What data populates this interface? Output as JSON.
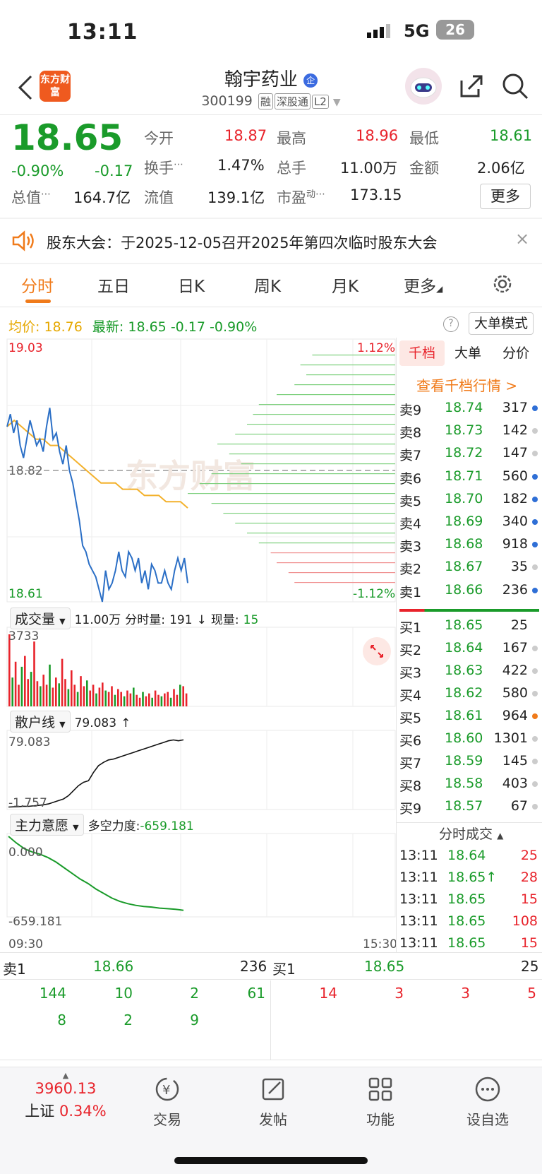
{
  "status_bar": {
    "time": "13:11",
    "network": "5G",
    "battery": "26"
  },
  "header": {
    "title": "翰宇药业",
    "code": "300199",
    "tags": [
      "融",
      "深股通",
      "L2"
    ],
    "logo_text": "东方财富"
  },
  "quote": {
    "price": "18.65",
    "change_pct": "-0.90%",
    "change": "-0.17",
    "open_label": "今开",
    "open": "18.87",
    "high_label": "最高",
    "high": "18.96",
    "low_label": "最低",
    "low": "18.61",
    "turnover_label": "换手",
    "turnover": "1.47%",
    "volume_label": "总手",
    "volume": "11.00万",
    "amount_label": "金额",
    "amount": "2.06亿",
    "mktcap_label": "总值",
    "mktcap": "164.7亿",
    "float_label": "流值",
    "float": "139.1亿",
    "pe_label": "市盈",
    "pe_sup": "动",
    "pe": "173.15",
    "more": "更多"
  },
  "notice": {
    "label": "股东大会：",
    "text": "于2025-12-05召开2025年第四次临时股东大会"
  },
  "tabs": [
    "分时",
    "五日",
    "日K",
    "周K",
    "月K",
    "更多"
  ],
  "chart_info": {
    "avg_label": "均价:",
    "avg": "18.76",
    "latest_label": "最新:",
    "latest": "18.65",
    "latest_chg": "-0.17",
    "latest_pct": "-0.90%",
    "mode_btn": "大单模式"
  },
  "chart_data": {
    "type": "line",
    "y_top": "19.03",
    "y_mid": "18.82",
    "y_bottom": "18.61",
    "pct_top": "1.12%",
    "pct_bottom": "-1.12%",
    "ylim": [
      18.61,
      19.03
    ],
    "price_series": [
      18.89,
      18.91,
      18.88,
      18.9,
      18.86,
      18.84,
      18.87,
      18.9,
      18.88,
      18.86,
      18.87,
      18.85,
      18.89,
      18.92,
      18.87,
      18.88,
      18.85,
      18.83,
      18.86,
      18.82,
      18.8,
      18.77,
      18.74,
      18.7,
      18.69,
      18.67,
      18.66,
      18.65,
      18.63,
      18.61,
      18.66,
      18.63,
      18.64,
      18.66,
      18.69,
      18.66,
      18.65,
      18.69,
      18.68,
      18.66,
      18.68,
      18.64,
      18.66,
      18.63,
      18.67,
      18.66,
      18.64,
      18.64,
      18.66,
      18.64,
      18.63,
      18.66,
      18.68,
      18.66,
      18.68,
      18.64
    ],
    "avg_series": [
      18.89,
      18.9,
      18.89,
      18.88,
      18.87,
      18.87,
      18.86,
      18.86,
      18.85,
      18.84,
      18.83,
      18.82,
      18.81,
      18.8,
      18.8,
      18.8,
      18.79,
      18.79,
      18.79,
      18.78,
      18.78,
      18.78,
      18.77,
      18.77,
      18.77,
      18.76
    ],
    "volume_label": "成交量",
    "volume_total": "11.00万",
    "volume_minute_label": "分时量:",
    "volume_minute": "191",
    "volume_now_label": "现量:",
    "volume_now": "15",
    "volume_max": "3733",
    "retail_label": "散户线",
    "retail_value": "79.083",
    "retail_top": "79.083",
    "retail_bottom": "-1.757",
    "main_label": "主力意愿",
    "main_sub_label": "多空力度:",
    "main_value": "-659.181",
    "main_top": "0.000",
    "main_bottom": "-659.181",
    "time_start": "09:30",
    "time_end": "15:30"
  },
  "order_book": {
    "tabs": [
      "千档",
      "大单",
      "分价"
    ],
    "link": "查看千档行情 >",
    "asks": [
      {
        "label": "卖9",
        "price": "18.74",
        "vol": "317",
        "dot": "#2f6fd6"
      },
      {
        "label": "卖8",
        "price": "18.73",
        "vol": "142",
        "dot": "#cccccc"
      },
      {
        "label": "卖7",
        "price": "18.72",
        "vol": "147",
        "dot": "#cccccc"
      },
      {
        "label": "卖6",
        "price": "18.71",
        "vol": "560",
        "dot": "#2f6fd6"
      },
      {
        "label": "卖5",
        "price": "18.70",
        "vol": "182",
        "dot": "#2f6fd6"
      },
      {
        "label": "卖4",
        "price": "18.69",
        "vol": "340",
        "dot": "#2f6fd6"
      },
      {
        "label": "卖3",
        "price": "18.68",
        "vol": "918",
        "dot": "#2f6fd6"
      },
      {
        "label": "卖2",
        "price": "18.67",
        "vol": "35",
        "dot": "#cccccc"
      },
      {
        "label": "卖1",
        "price": "18.66",
        "vol": "236",
        "dot": "#2f6fd6"
      }
    ],
    "bids": [
      {
        "label": "买1",
        "price": "18.65",
        "vol": "25",
        "dot": ""
      },
      {
        "label": "买2",
        "price": "18.64",
        "vol": "167",
        "dot": "#cccccc"
      },
      {
        "label": "买3",
        "price": "18.63",
        "vol": "422",
        "dot": "#cccccc"
      },
      {
        "label": "买4",
        "price": "18.62",
        "vol": "580",
        "dot": "#cccccc"
      },
      {
        "label": "买5",
        "price": "18.61",
        "vol": "964",
        "dot": "#f07b1b"
      },
      {
        "label": "买6",
        "price": "18.60",
        "vol": "1301",
        "dot": "#cccccc"
      },
      {
        "label": "买7",
        "price": "18.59",
        "vol": "145",
        "dot": "#cccccc"
      },
      {
        "label": "买8",
        "price": "18.58",
        "vol": "403",
        "dot": "#cccccc"
      },
      {
        "label": "买9",
        "price": "18.57",
        "vol": "67",
        "dot": "#cccccc"
      }
    ],
    "ticks_label": "分时成交",
    "ticks": [
      {
        "time": "13:11",
        "price": "18.64",
        "arrow": "",
        "vol": "25"
      },
      {
        "time": "13:11",
        "price": "18.65",
        "arrow": "↑",
        "vol": "28"
      },
      {
        "time": "13:11",
        "price": "18.65",
        "arrow": "",
        "vol": "15"
      },
      {
        "time": "13:11",
        "price": "18.65",
        "arrow": "",
        "vol": "108"
      },
      {
        "time": "13:11",
        "price": "18.65",
        "arrow": "",
        "vol": "15"
      }
    ]
  },
  "bottom_book": {
    "sell_label": "卖1",
    "sell_price": "18.66",
    "sell_vol": "236",
    "buy_label": "买1",
    "buy_price": "18.65",
    "buy_vol": "25",
    "sell_row1": [
      "144",
      "10",
      "2",
      "61"
    ],
    "sell_row2": [
      "8",
      "2",
      "9"
    ],
    "buy_row1": [
      "14",
      "3",
      "3",
      "5"
    ]
  },
  "bottom_nav": {
    "index_value": "3960.13",
    "index_name": "上证",
    "index_pct": "0.34%",
    "items": [
      "交易",
      "发帖",
      "功能",
      "设自选"
    ]
  }
}
